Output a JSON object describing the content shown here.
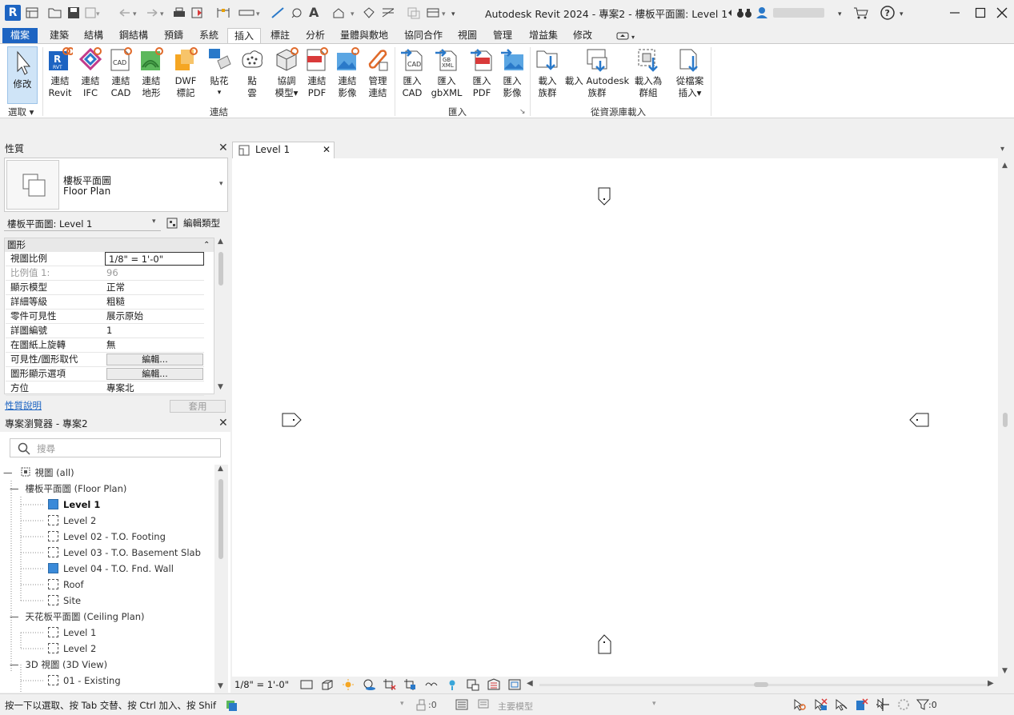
{
  "app": {
    "title": "Autodesk Revit 2024 - 專案2 - 樓板平面圖: Level 1",
    "logo_letter": "R"
  },
  "tabs": [
    "檔案",
    "建築",
    "結構",
    "鋼結構",
    "預鑄",
    "系統",
    "插入",
    "標註",
    "分析",
    "量體與敷地",
    "協同合作",
    "視圖",
    "管理",
    "增益集",
    "修改"
  ],
  "ribbon": {
    "modify": {
      "label": "修改",
      "panel": "選取"
    },
    "link_buttons": [
      {
        "line1": "連結",
        "line2": "Revit"
      },
      {
        "line1": "連結",
        "line2": "IFC"
      },
      {
        "line1": "連結",
        "line2": "CAD"
      },
      {
        "line1": "連結",
        "line2": "地形"
      },
      {
        "line1": "DWF",
        "line2": "標記"
      },
      {
        "line1": "貼花",
        "line2": ""
      },
      {
        "line1": "點",
        "line2": "雲"
      },
      {
        "line1": "協調",
        "line2": "模型"
      },
      {
        "line1": "連結",
        "line2": "PDF"
      },
      {
        "line1": "連結",
        "line2": "影像"
      },
      {
        "line1": "管理",
        "line2": "連結"
      }
    ],
    "link_panel": "連結",
    "import_buttons": [
      {
        "line1": "匯入",
        "line2": "CAD"
      },
      {
        "line1": "匯入",
        "line2": "gbXML"
      },
      {
        "line1": "匯入",
        "line2": "PDF"
      },
      {
        "line1": "匯入",
        "line2": "影像"
      }
    ],
    "import_panel": "匯入",
    "library_buttons": [
      {
        "line1": "載入",
        "line2": "族群"
      },
      {
        "line1": "載入 Autodesk",
        "line2": "族群"
      },
      {
        "line1": "載入為",
        "line2": "群組"
      },
      {
        "line1": "從檔案",
        "line2": "插入"
      }
    ],
    "library_panel": "從資源庫載入"
  },
  "properties": {
    "title": "性質",
    "type_name": "樓板平面圖",
    "type_name_en": "Floor Plan",
    "selector": "樓板平面圖: Level 1",
    "edit_type": "編輯類型",
    "group": "圖形",
    "rows": [
      {
        "key": "視圖比例",
        "value": "1/8\" = 1'-0\""
      },
      {
        "key": "比例值 1:",
        "value": "96"
      },
      {
        "key": "顯示模型",
        "value": "正常"
      },
      {
        "key": "詳細等級",
        "value": "粗糙"
      },
      {
        "key": "零件可見性",
        "value": "展示原始"
      },
      {
        "key": "詳圖編號",
        "value": "1"
      },
      {
        "key": "在圖紙上旋轉",
        "value": "無"
      },
      {
        "key": "可見性/圖形取代",
        "value": "編輯..."
      },
      {
        "key": "圖形顯示選項",
        "value": "編輯..."
      },
      {
        "key": "方位",
        "value": "專案北"
      }
    ],
    "help_link": "性質說明",
    "apply": "套用"
  },
  "browser": {
    "title": "專案瀏覽器 - 專案2",
    "search_placeholder": "搜尋",
    "root": "視圖 (all)",
    "floor_plans": "樓板平面圖 (Floor Plan)",
    "floor_items": [
      "Level 1",
      "Level 2",
      "Level 02 - T.O. Footing",
      "Level 03 - T.O. Basement Slab",
      "Level 04 - T.O. Fnd. Wall",
      "Roof",
      "Site"
    ],
    "ceiling_plans": "天花板平面圖 (Ceiling Plan)",
    "ceiling_items": [
      "Level 1",
      "Level 2"
    ],
    "views_3d": "3D 視圖 (3D View)",
    "items_3d": [
      "01 - Existing"
    ]
  },
  "view": {
    "tab": "Level 1",
    "scale": "1/8\" = 1'-0\""
  },
  "status": {
    "hint": "按一下以選取、按 Tab 交替、按 Ctrl 加入、按 Shif",
    "workset_count": ":0",
    "main_model": "主要模型",
    "filter_count": ":0"
  },
  "colors": {
    "accent": "#1d64c2",
    "selected_view": "#3a8ad9"
  }
}
